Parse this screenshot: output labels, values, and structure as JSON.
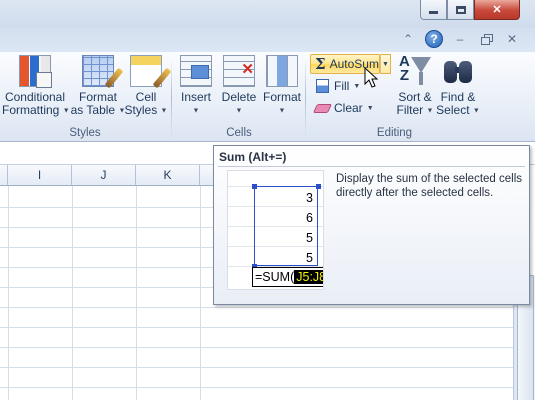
{
  "ribbon": {
    "styles_group": {
      "label": "Styles",
      "conditional_formatting": [
        "Conditional",
        "Formatting"
      ],
      "format_as_table": [
        "Format",
        "as Table"
      ],
      "cell_styles": [
        "Cell",
        "Styles"
      ]
    },
    "cells_group": {
      "label": "Cells",
      "insert": "Insert",
      "delete": "Delete",
      "format": "Format"
    },
    "editing_group": {
      "label": "Editing",
      "autosum": "AutoSum",
      "fill": "Fill",
      "clear": "Clear",
      "sort_filter": [
        "Sort &",
        "Filter"
      ],
      "find_select": [
        "Find &",
        "Select"
      ]
    }
  },
  "help": {
    "icon": "?"
  },
  "sheet": {
    "columns": [
      "I",
      "J",
      "K"
    ]
  },
  "tooltip": {
    "title": "Sum (Alt+=)",
    "description": "Display the sum of the selected cells directly after the selected cells.",
    "example_values": [
      "3",
      "6",
      "5",
      "5"
    ],
    "formula_prefix": "=SUM(",
    "formula_ref": "J5:J8",
    "formula_suffix": ")"
  },
  "colors": {
    "autosum_highlight": "#ffe48c",
    "selection_blue": "#2c4fc7",
    "close_button": "#c8483a"
  }
}
